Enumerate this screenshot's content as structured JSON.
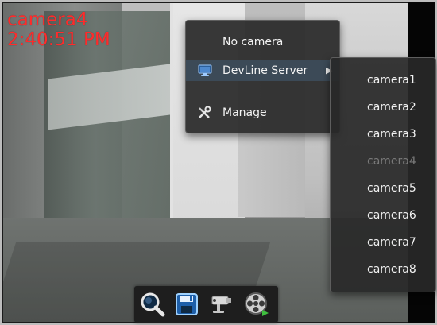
{
  "overlay": {
    "camera_name": "camera4",
    "timestamp": "2:40:51 PM"
  },
  "context_menu": {
    "no_camera_label": "No camera",
    "server_label": "DevLine Server",
    "server_icon": "monitor-icon",
    "manage_label": "Manage",
    "manage_icon": "tools-icon",
    "submenu_arrow": "▶"
  },
  "submenu": {
    "items": [
      {
        "label": "camera1",
        "disabled": false
      },
      {
        "label": "camera2",
        "disabled": false
      },
      {
        "label": "camera3",
        "disabled": false
      },
      {
        "label": "camera4",
        "disabled": true
      },
      {
        "label": "camera5",
        "disabled": false
      },
      {
        "label": "camera6",
        "disabled": false
      },
      {
        "label": "camera7",
        "disabled": false
      },
      {
        "label": "camera8",
        "disabled": false
      }
    ]
  },
  "toolbar": {
    "buttons": [
      {
        "icon": "zoom-icon"
      },
      {
        "icon": "save-icon"
      },
      {
        "icon": "ptz-camera-icon"
      },
      {
        "icon": "video-reel-icon"
      }
    ]
  },
  "colors": {
    "overlay_text": "#ff2b2b",
    "menu_bg": "#282828",
    "menu_highlight": "#3c4a57",
    "disabled_text": "#7a7a7a"
  }
}
